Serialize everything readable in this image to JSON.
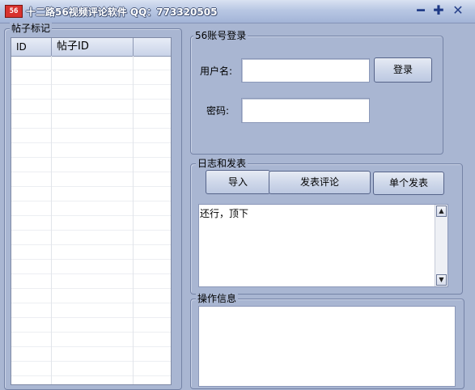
{
  "window": {
    "icon_text": "56",
    "title": "十二路56视频评论软件  QQ：773320505",
    "minimize_symbol": "━",
    "maximize_symbol": "✚",
    "close_symbol": "✕"
  },
  "post_panel": {
    "legend": "帖子标记",
    "columns": [
      "ID",
      "帖子ID",
      ""
    ],
    "rows": []
  },
  "login": {
    "legend": "56账号登录",
    "username_label": "用户名:",
    "username_value": "",
    "password_label": "密码:",
    "password_value": "",
    "login_button": "登录"
  },
  "log": {
    "legend": "日志和发表",
    "import_button": "导入",
    "post_comment_button": "发表评论",
    "single_post_button": "单个发表",
    "content": "还行，顶下"
  },
  "ops": {
    "legend": "操作信息",
    "content": ""
  },
  "icons": {
    "up_arrow": "▲",
    "down_arrow": "▼"
  },
  "colors": {
    "window_bg": "#a9b6d2",
    "app_icon": "#d8322e"
  }
}
